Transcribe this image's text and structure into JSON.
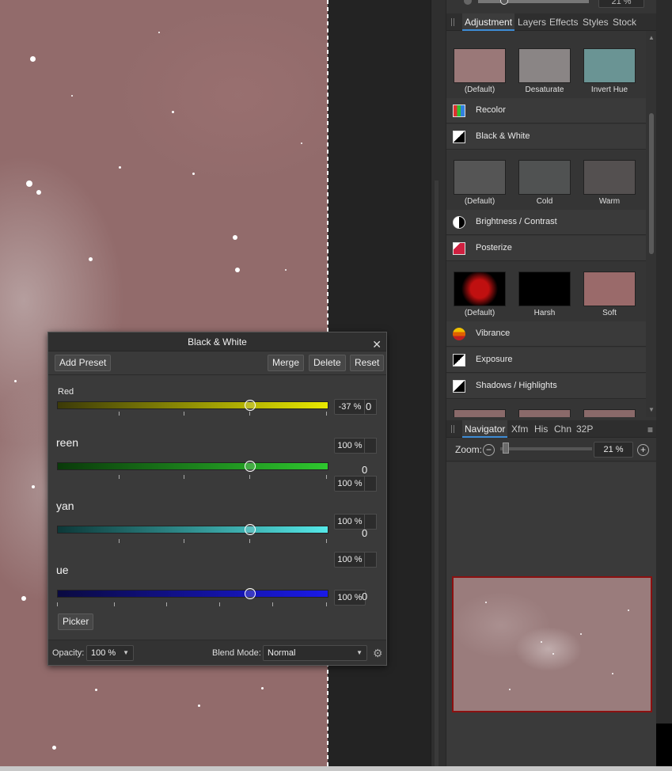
{
  "zoom_top": "21 %",
  "studio": {
    "tabs": [
      "Adjustment",
      "Layers",
      "Effects",
      "Styles",
      "Stock"
    ],
    "active_tab": "Adjustment",
    "adjustments": {
      "levels_presets": [
        "(Default)",
        "Desaturate",
        "Invert Hue"
      ],
      "recolor": "Recolor",
      "black_white": "Black & White",
      "bw_presets": [
        "(Default)",
        "Cold",
        "Warm"
      ],
      "brightness_contrast": "Brightness / Contrast",
      "posterize": "Posterize",
      "posterize_presets": [
        "(Default)",
        "Harsh",
        "Soft"
      ],
      "vibrance": "Vibrance",
      "exposure": "Exposure",
      "shadows_highlights": "Shadows / Highlights"
    },
    "navigator_tabs": [
      "Navigator",
      "Xfm",
      "His",
      "Chn",
      "32P"
    ],
    "active_navigator_tab": "Navigator",
    "zoom_label": "Zoom:",
    "zoom_value": "21 %",
    "menu_icon": "≡"
  },
  "dialog": {
    "title": "Black & White",
    "close": "✕",
    "buttons": {
      "add_preset": "Add Preset",
      "merge": "Merge",
      "delete": "Delete",
      "reset": "Reset"
    },
    "sliders": [
      {
        "label": "Red",
        "value": "-37 %",
        "level_pct": 71,
        "color_from": "#3c3a08",
        "color_to": "#e8e800"
      },
      {
        "label": "reen",
        "value": "100 %",
        "level_pct": 71,
        "color_from": "#0a3a0a",
        "color_to": "#2ec82e"
      },
      {
        "label": "yan",
        "value": "100 %",
        "level_pct": 71,
        "color_from": "#0d3838",
        "color_to": "#55e8e8"
      },
      {
        "label": "ue",
        "value": "100 %",
        "level_pct": 71,
        "color_from": "#0a0a40",
        "color_to": "#1a1ae8"
      }
    ],
    "stray_fields": [
      "100 %",
      "100 %"
    ],
    "stub_chars": [
      "0",
      "0",
      "0",
      "0"
    ],
    "picker": "Picker",
    "opacity_label": "Opacity:",
    "opacity_value": "100 %",
    "blend_label": "Blend Mode:",
    "blend_value": "Normal",
    "gear_icon": "⚙"
  }
}
